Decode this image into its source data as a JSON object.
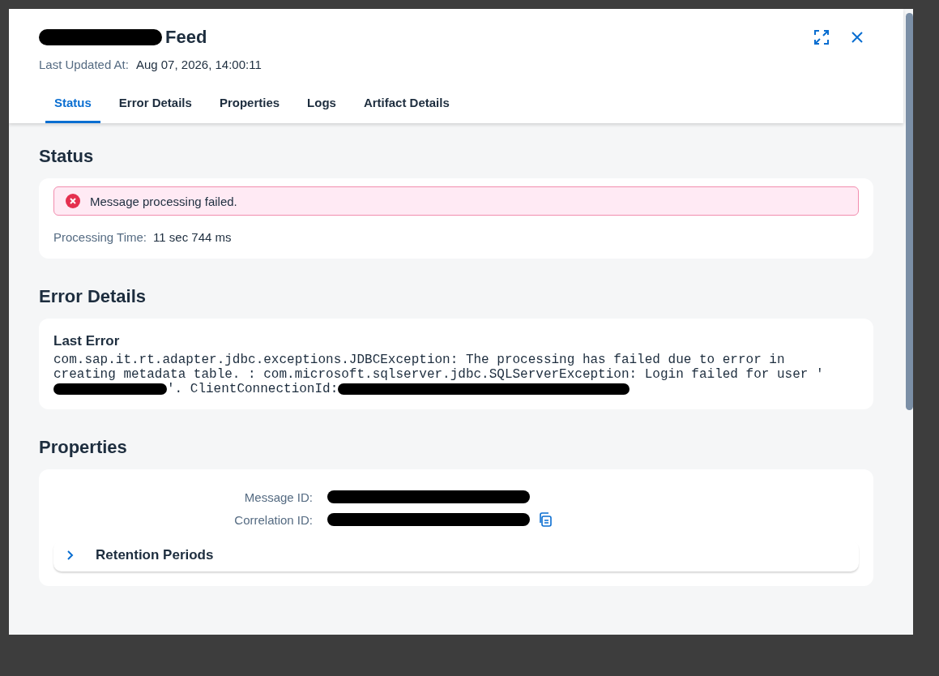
{
  "dialog": {
    "title": [
      {
        "kind": "redacted"
      },
      {
        "kind": "text",
        "text": "Feed"
      }
    ],
    "updated_label": "Last Updated At:",
    "updated_value": "Aug 07, 2026, 14:00:11"
  },
  "tabs": [
    {
      "label": "Status",
      "selected": true
    },
    {
      "label": "Error Details",
      "selected": false
    },
    {
      "label": "Properties",
      "selected": false
    },
    {
      "label": "Logs",
      "selected": false
    },
    {
      "label": "Artifact Details",
      "selected": false
    }
  ],
  "status": {
    "heading": "Status",
    "message": "Message processing failed.",
    "time_label": "Processing Time:",
    "time_value": "11 sec 744 ms"
  },
  "error_details": {
    "heading": "Error Details",
    "title": "Last Error",
    "text": [
      {
        "kind": "text",
        "text": "com.sap.it.rt.adapter.jdbc.exceptions.JDBCException: The processing has failed due to error in creating metadata table. : com.microsoft.sqlserver.jdbc.SQLServerException: Login failed for user '"
      },
      {
        "kind": "redacted"
      },
      {
        "kind": "text",
        "text": "'. ClientConnectionId:"
      },
      {
        "kind": "redacted"
      }
    ]
  },
  "properties": {
    "heading": "Properties",
    "fields": [
      {
        "label": "Message ID:",
        "copy": false
      },
      {
        "label": "Correlation ID:",
        "copy": true
      }
    ],
    "retention": {
      "label": "Retention Periods",
      "expanded": false
    }
  }
}
